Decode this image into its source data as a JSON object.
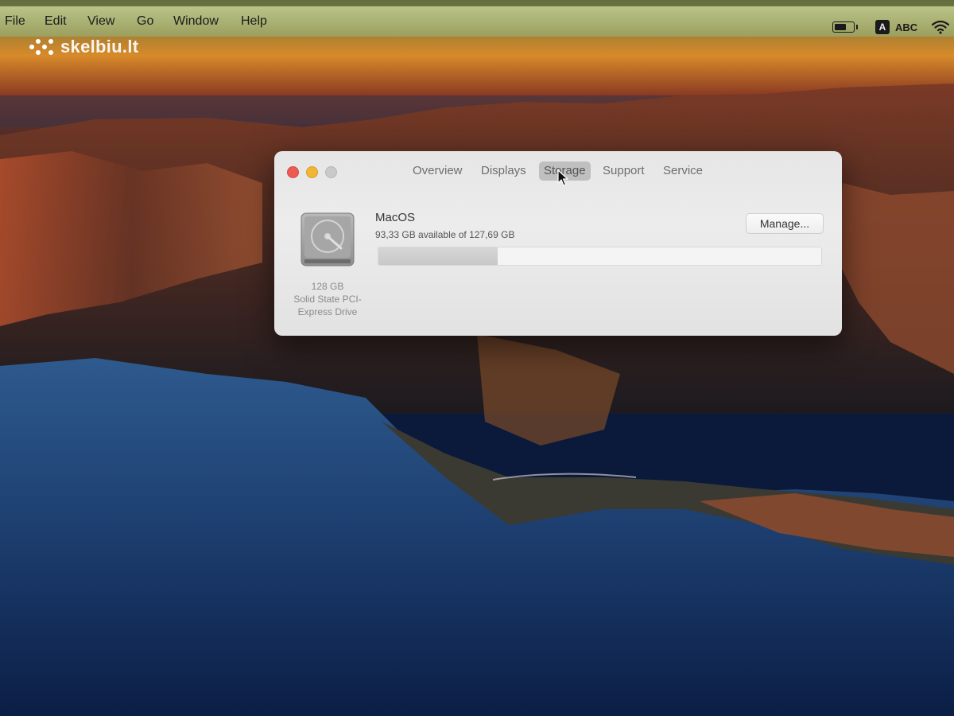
{
  "watermark": {
    "text": "skelbiu.lt"
  },
  "menubar": {
    "items": [
      "File",
      "Edit",
      "View",
      "Go",
      "Window",
      "Help"
    ],
    "battery_level": 0.65,
    "input_source_badge": "A",
    "input_source_label": "ABC"
  },
  "window": {
    "tabs": [
      "Overview",
      "Displays",
      "Storage",
      "Support",
      "Service"
    ],
    "selected_tab": "Storage",
    "disk": {
      "size": "128 GB",
      "type": "Solid State PCI-Express Drive",
      "type_line1": "Solid State PCI-",
      "type_line2": "Express Drive"
    },
    "volume": {
      "name": "MacOS",
      "availability": "93,33 GB available of 127,69 GB",
      "used_fraction": 0.27
    },
    "manage_button": "Manage..."
  },
  "colors": {
    "close": "#ec5b52",
    "minimize": "#f2b637",
    "zoom_disabled": "#c9c9c9"
  }
}
